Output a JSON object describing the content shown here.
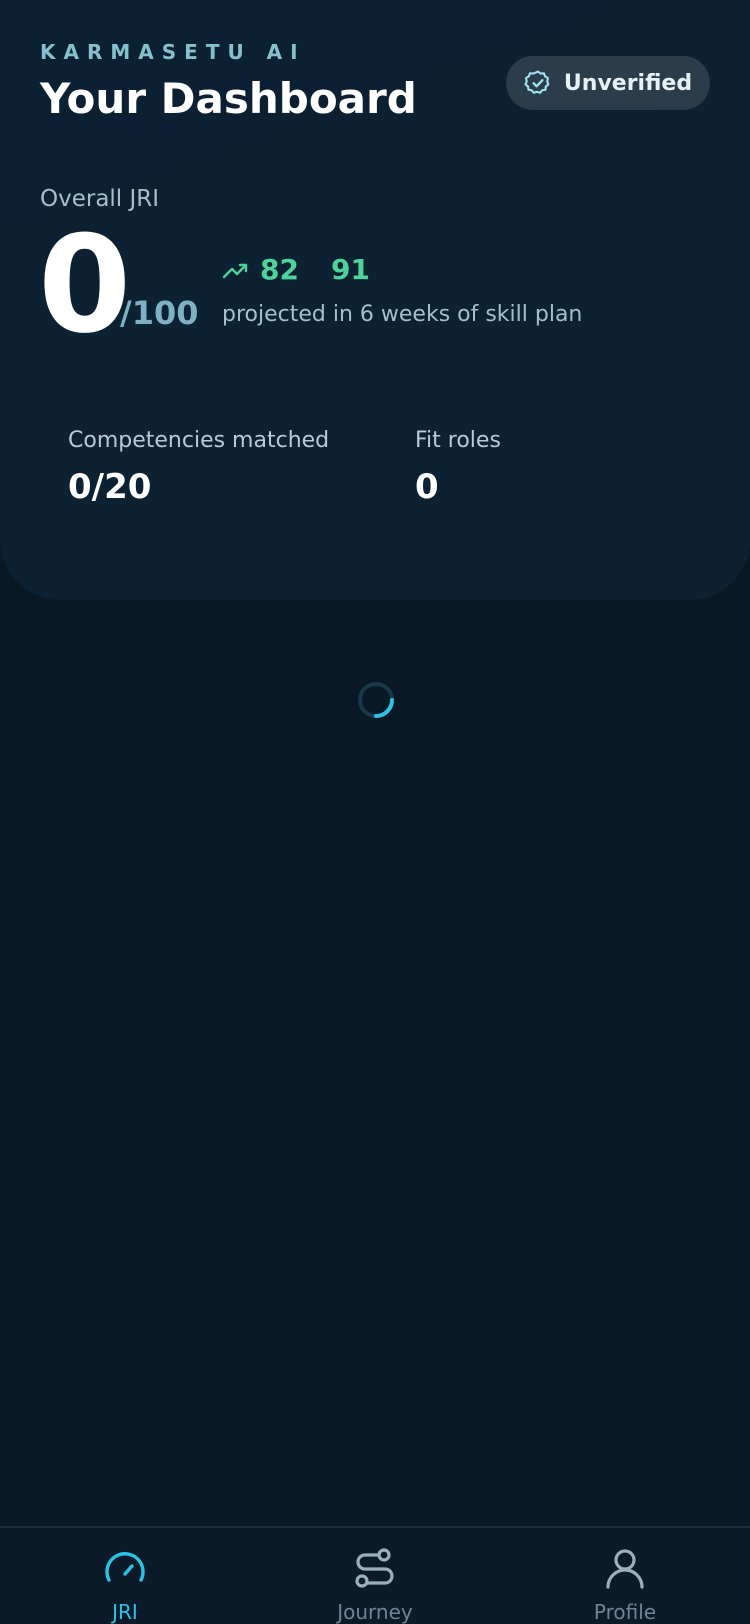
{
  "header": {
    "brand": "KARMASETU AI",
    "title": "Your Dashboard",
    "verification_badge": "Unverified"
  },
  "score": {
    "label": "Overall JRI",
    "value": "0",
    "max": "/100",
    "projection_value_1": "82",
    "projection_value_2": "91",
    "projection_text": "projected in 6 weeks of skill plan"
  },
  "stats": [
    {
      "label": "Competencies matched",
      "value": "0/20"
    },
    {
      "label": "Fit roles",
      "value": "0"
    }
  ],
  "tabs": [
    {
      "label": "JRI",
      "icon": "gauge-icon",
      "active": true
    },
    {
      "label": "Journey",
      "icon": "route-icon",
      "active": false
    },
    {
      "label": "Profile",
      "icon": "user-icon",
      "active": false
    }
  ],
  "colors": {
    "background": "#081824",
    "accent": "#2cc2e6",
    "positive": "#4fd39b"
  }
}
